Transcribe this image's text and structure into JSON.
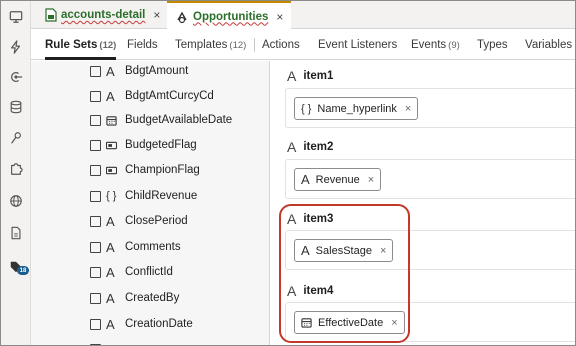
{
  "editor_tabs": [
    {
      "label": "accounts-detail",
      "close": "×"
    },
    {
      "label": "Opportunities",
      "close": "×"
    }
  ],
  "subtabs": [
    {
      "label": "Rule Sets",
      "count": "(12)"
    },
    {
      "label": "Fields",
      "count": ""
    },
    {
      "label": "Templates",
      "count": "(12)"
    },
    {
      "label": "Actions",
      "count": ""
    },
    {
      "label": "Event Listeners",
      "count": ""
    },
    {
      "label": "Events",
      "count": "(9)"
    },
    {
      "label": "Types",
      "count": ""
    },
    {
      "label": "Variables",
      "count": ""
    }
  ],
  "rail": {
    "icons": [
      "desktop-icon",
      "lightning-icon",
      "service-icon",
      "database-icon",
      "flow-icon",
      "puzzle-icon",
      "globe-icon",
      "document-icon",
      "tag-icon"
    ],
    "badge": "18"
  },
  "fields": [
    {
      "name": "BdgtAmount",
      "type": "text"
    },
    {
      "name": "BdgtAmtCurcyCd",
      "type": "text"
    },
    {
      "name": "BudgetAvailableDate",
      "type": "date"
    },
    {
      "name": "BudgetedFlag",
      "type": "boolean"
    },
    {
      "name": "ChampionFlag",
      "type": "boolean"
    },
    {
      "name": "ChildRevenue",
      "type": "object"
    },
    {
      "name": "ClosePeriod",
      "type": "text"
    },
    {
      "name": "Comments",
      "type": "text"
    },
    {
      "name": "ConflictId",
      "type": "text"
    },
    {
      "name": "CreatedBy",
      "type": "text"
    },
    {
      "name": "CreationDate",
      "type": "text"
    }
  ],
  "items": [
    {
      "label": "item1",
      "chip": "Name_hyperlink",
      "chip_icon": "object",
      "remove": "×"
    },
    {
      "label": "item2",
      "chip": "Revenue",
      "chip_icon": "text",
      "remove": "×"
    },
    {
      "label": "item3",
      "chip": "SalesStage",
      "chip_icon": "text",
      "remove": "×"
    },
    {
      "label": "item4",
      "chip": "EffectiveDate",
      "chip_icon": "date",
      "remove": "×"
    }
  ],
  "colors": {
    "highlight": "#c0392b",
    "tab_accent": "#c38a00",
    "tab_name": "#2c6e2c",
    "badge": "#1a5d8f"
  }
}
